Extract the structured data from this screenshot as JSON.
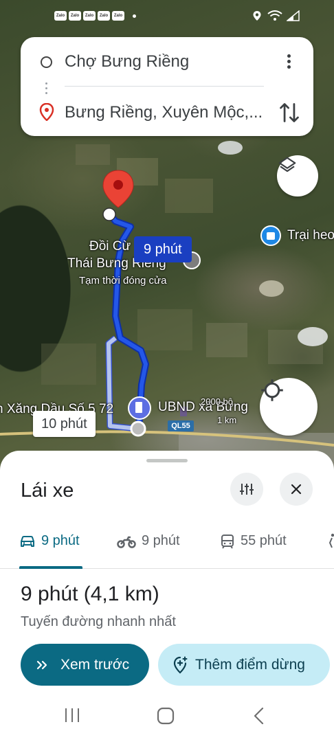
{
  "status_bar": {
    "notif_icons": [
      "Zalo",
      "Zalo",
      "Zalo",
      "Zalo",
      "Zalo"
    ]
  },
  "search": {
    "origin": "Chợ Bưng Riềng",
    "destination": "Bưng Riềng, Xuyên Mộc,..."
  },
  "map": {
    "poi_name_line1": "Đồi Cừ",
    "poi_name_line2": "Thái Bưng Riềng",
    "poi_status": "Tạm thời đóng cửa",
    "trai_label": "Trại heo",
    "fuel_label": "n Xăng Dầu Số 5 72",
    "ubnd_label": "UBND xã Bưng",
    "distance_scale": "2000 bộ",
    "km_scale": "1 km",
    "road_shield": "QL55",
    "main_route_time": "9 phút",
    "alt_route_time": "10 phút",
    "colors": {
      "route_main": "#1a3fc1",
      "route_alt": "#a7b8e8",
      "pin": "#ea4335"
    }
  },
  "sheet": {
    "title": "Lái xe",
    "tabs": [
      {
        "icon": "car-icon",
        "label": "9 phút",
        "active": true
      },
      {
        "icon": "motorcycle-icon",
        "label": "9 phút",
        "active": false
      },
      {
        "icon": "transit-icon",
        "label": "55 phút",
        "active": false
      },
      {
        "icon": "walk-icon",
        "label": "",
        "active": false
      }
    ],
    "route_summary": "9 phút (4,1 km)",
    "route_desc": "Tuyến đường nhanh nhất",
    "preview_label": "Xem trước",
    "add_stop_label": "Thêm điểm dừng",
    "accent": "#0b6a83"
  }
}
